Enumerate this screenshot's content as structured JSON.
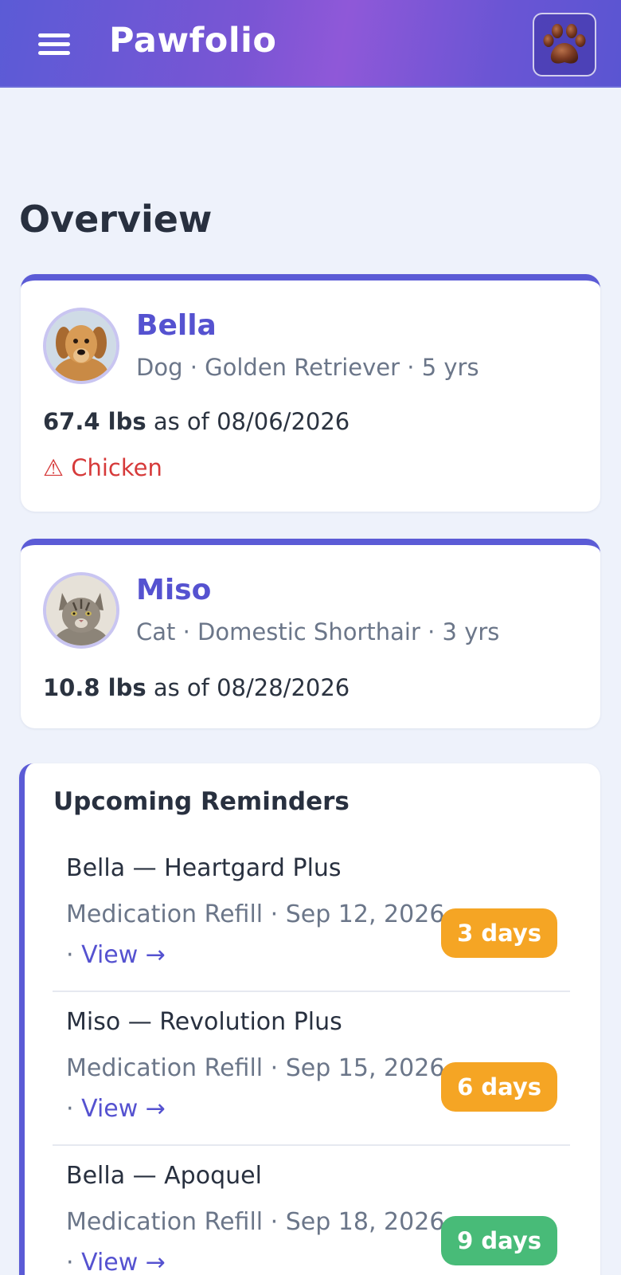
{
  "app": {
    "title": "Pawfolio",
    "menu_icon": "hamburger-menu-icon",
    "logo_icon": "paw-print-icon"
  },
  "page": {
    "title": "Overview"
  },
  "pets": [
    {
      "name": "Bella",
      "meta": "Dog · Golden Retriever · 5 yrs",
      "weight": "67.4 lbs",
      "weight_suffix": "as of 08/06/2026",
      "allergy_icon": "⚠",
      "allergy": "Chicken",
      "avatar": "golden-retriever-photo"
    },
    {
      "name": "Miso",
      "meta": "Cat · Domestic Shorthair · 3 yrs",
      "weight": "10.8 lbs",
      "weight_suffix": "as of 08/28/2026",
      "avatar": "tabby-cat-photo"
    }
  ],
  "reminders": {
    "title": "Upcoming Reminders",
    "items": [
      {
        "title": "Bella — Heartgard Plus",
        "detail": "Medication Refill · Sep 12, 2026 · ",
        "link": "View →",
        "badge": "3 days",
        "badge_color": "#f5a524"
      },
      {
        "title": "Miso — Revolution Plus",
        "detail": "Medication Refill · Sep 15, 2026 · ",
        "link": "View →",
        "badge": "6 days",
        "badge_color": "#f5a524"
      },
      {
        "title": "Bella — Apoquel",
        "detail": "Medication Refill · Sep 18, 2026 · ",
        "link": "View →",
        "badge": "9 days",
        "badge_color": "#48bb78"
      }
    ]
  },
  "colors": {
    "accent": "#5b5bd6",
    "allergy": "#d63a3a",
    "background": "#eef2fb"
  }
}
